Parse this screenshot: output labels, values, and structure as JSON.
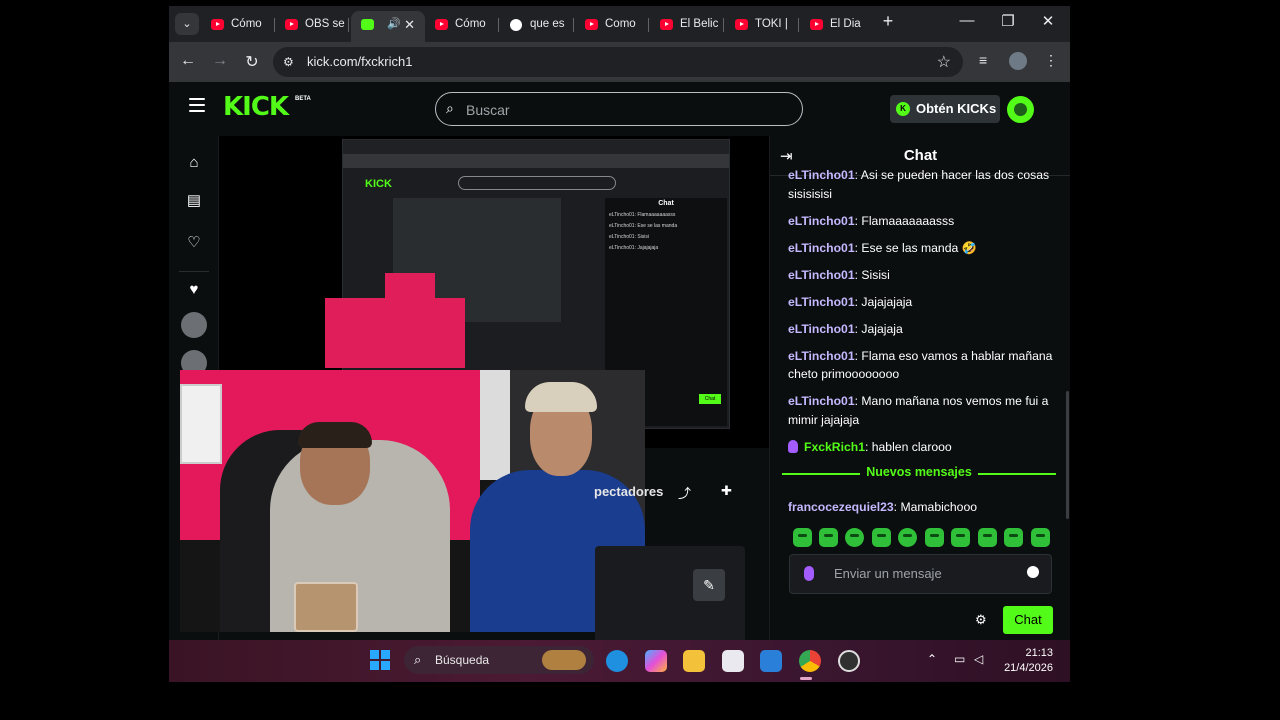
{
  "browser": {
    "tabs": [
      {
        "title": "Cómo",
        "icon": "youtube-icon"
      },
      {
        "title": "OBS se",
        "icon": "youtube-icon"
      },
      {
        "title": "",
        "icon": "kick-icon",
        "active": true
      },
      {
        "title": "Cómo",
        "icon": "youtube-icon"
      },
      {
        "title": "que es",
        "icon": "google-icon"
      },
      {
        "title": "Como",
        "icon": "youtube-icon"
      },
      {
        "title": "El Belic",
        "icon": "youtube-icon"
      },
      {
        "title": "TOKI |",
        "icon": "youtube-icon"
      },
      {
        "title": "El Dia",
        "icon": "youtube-icon"
      }
    ],
    "url": "kick.com/fxckrich1"
  },
  "kick": {
    "logo": "KICK",
    "beta": "BETA",
    "search_placeholder": "Buscar",
    "kicks_button": "Obtén KICKs"
  },
  "stream": {
    "viewers_label": "pectadores"
  },
  "chat": {
    "title": "Chat",
    "messages": [
      {
        "user": "eLTincho01",
        "text": "Asi se pueden hacer las dos cosas sisisisisi"
      },
      {
        "user": "eLTincho01",
        "text": "Flamaaaaaaasss"
      },
      {
        "user": "eLTincho01",
        "text": "Ese se las manda 🤣"
      },
      {
        "user": "eLTincho01",
        "text": "Sisisi"
      },
      {
        "user": "eLTincho01",
        "text": "Jajajajaja"
      },
      {
        "user": "eLTincho01",
        "text": "Jajajaja"
      },
      {
        "user": "eLTincho01",
        "text": "Flama eso vamos a hablar mañana cheto primoooooooo"
      },
      {
        "user": "eLTincho01",
        "text": "Mano mañana nos vemos me fui a mimir jajajaja"
      },
      {
        "user": "FxckRich1",
        "text": "hablen clarooo"
      }
    ],
    "new_messages_label": "Nuevos mensajes",
    "new_message": {
      "user": "francocezequiel23",
      "text": "Mamabichooo"
    },
    "input_placeholder": "Enviar un mensaje",
    "send_label": "Chat"
  },
  "taskbar": {
    "search_label": "Búsqueda",
    "time": "21:13",
    "date": "21/4/2026"
  },
  "colors": {
    "kick_green": "#53fc18",
    "chat_username": "#c4b8ff",
    "background": "#0b0e0f"
  }
}
